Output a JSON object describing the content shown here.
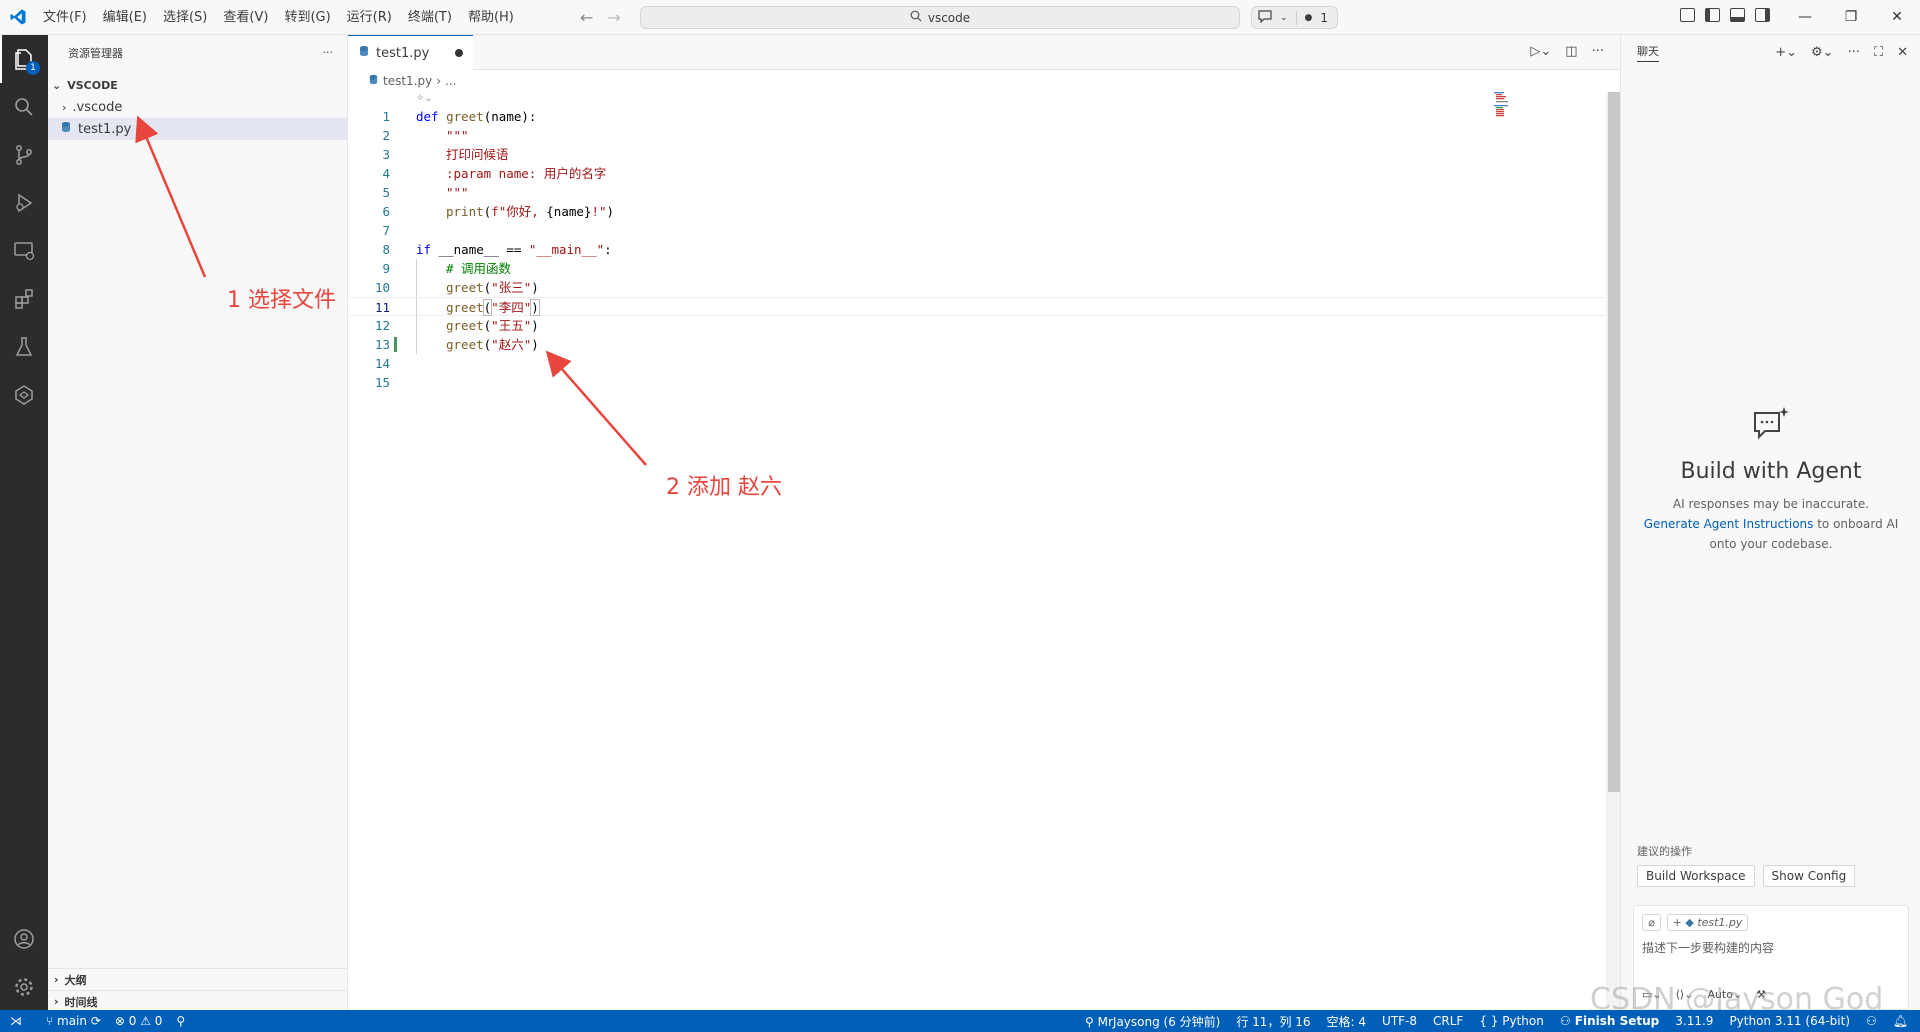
{
  "titlebar": {
    "menu": [
      "文件(F)",
      "编辑(E)",
      "选择(S)",
      "查看(V)",
      "转到(G)",
      "运行(R)",
      "终端(T)",
      "帮助(H)"
    ],
    "search": "vscode",
    "chat_count": "1"
  },
  "activity": {
    "explorer_badge": "1"
  },
  "sidebar": {
    "title": "资源管理器",
    "more": "···",
    "root": "VSCODE",
    "items": [
      {
        "label": ".vscode",
        "type": "folder"
      },
      {
        "label": "test1.py",
        "type": "file"
      }
    ],
    "outline": "大纲",
    "timeline": "时间线"
  },
  "editor": {
    "tab_label": "test1.py",
    "breadcrumb_file": "test1.py",
    "breadcrumb_rest": "...",
    "lines": [
      {
        "n": "1"
      },
      {
        "n": "2"
      },
      {
        "n": "3"
      },
      {
        "n": "4"
      },
      {
        "n": "5"
      },
      {
        "n": "6"
      },
      {
        "n": "7"
      },
      {
        "n": "8"
      },
      {
        "n": "9"
      },
      {
        "n": "10"
      },
      {
        "n": "11"
      },
      {
        "n": "12"
      },
      {
        "n": "13"
      },
      {
        "n": "14"
      },
      {
        "n": "15"
      }
    ],
    "code": {
      "l1_kw": "def",
      "l1_fn": "greet",
      "l1_rest": "(name):",
      "l2": "\"\"\"",
      "l3": "打印问候语",
      "l4": ":param name: 用户的名字",
      "l5": "\"\"\"",
      "l6_fn": "print",
      "l6_a": "(",
      "l6_str": "f\"你好, ",
      "l6_b": "{name}",
      "l6_str2": "!\"",
      "l6_c": ")",
      "l8_kw": "if",
      "l8_rest": " __name__ == ",
      "l8_str": "\"__main__\"",
      "l8_end": ":",
      "l9": "# 调用函数",
      "l10_fn": "greet",
      "l10_str": "\"张三\"",
      "l11_fn": "greet",
      "l11_str": "\"李四\"",
      "l12_fn": "greet",
      "l12_str": "\"王五\"",
      "l13_fn": "greet",
      "l13_str": "\"赵六\""
    }
  },
  "annotations": {
    "a1": "1 选择文件",
    "a2": "2 添加 赵六"
  },
  "chat": {
    "tab": "聊天",
    "heading": "Build with Agent",
    "disclaimer": "AI responses may be inaccurate.",
    "link": "Generate Agent Instructions",
    "link_rest": " to onboard AI",
    "line3": "onto your codebase.",
    "suggest_label": "建议的操作",
    "btn1": "Build Workspace",
    "btn2": "Show Config",
    "chip_file": "test1.py",
    "placeholder": "描述下一步要构建的内容",
    "mode": "Auto"
  },
  "statusbar": {
    "branch": "main",
    "errors": "0",
    "warnings": "0",
    "author": "MrJaysong (6 分钟前)",
    "position": "行 11，列 16",
    "spaces": "空格: 4",
    "encoding": "UTF-8",
    "eol": "CRLF",
    "language": "Python",
    "finish": "Finish Setup",
    "version": "3.11.9",
    "interpreter": "Python 3.11 (64-bit)"
  },
  "watermark": "CSDN @Jayson God",
  "colors": {
    "accent": "#005fb8",
    "annotation": "#e8453c",
    "keyword": "#0000ff",
    "string": "#a31515",
    "comment": "#008000"
  }
}
